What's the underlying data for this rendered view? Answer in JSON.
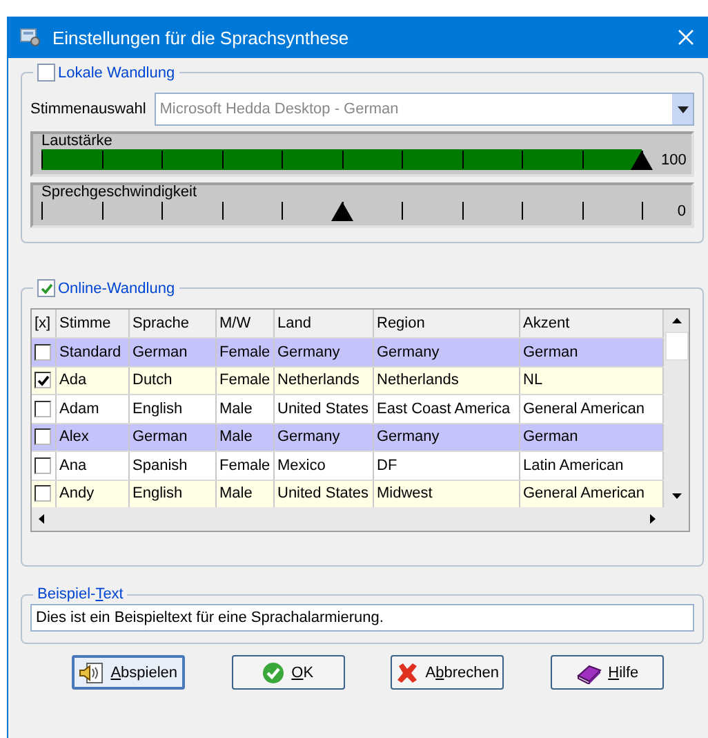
{
  "window": {
    "title": "Einstellungen für die Sprachsynthese"
  },
  "local_group": {
    "title": "Lokale Wandlung",
    "checked": false,
    "voice_select": {
      "label": "Stimmenauswahl",
      "value": "Microsoft Hedda Desktop - German"
    },
    "sliders": [
      {
        "kind": "filled",
        "label": "Lautstärke",
        "level": 1.0,
        "reading": "100"
      },
      {
        "kind": "plain",
        "label": "Sprechgeschwindigkeit",
        "level": 0.5,
        "reading": "0"
      }
    ]
  },
  "online_group": {
    "title": "Online-Wandlung",
    "checked": true,
    "table": {
      "checkbox_header": "[x]",
      "columns": [
        "Stimme",
        "Sprache",
        "M/W",
        "Land",
        "Region",
        "Akzent"
      ],
      "rows": [
        {
          "checked": false,
          "color": "#c4c4fa",
          "cells": [
            "Standard",
            "German",
            "Female",
            "Germany",
            "Germany",
            "German"
          ]
        },
        {
          "checked": true,
          "color": "#ffffe6",
          "cells": [
            "Ada",
            "Dutch",
            "Female",
            "Netherlands",
            "Netherlands",
            "NL"
          ]
        },
        {
          "checked": false,
          "color": "#ffffff",
          "cells": [
            "Adam",
            "English",
            "Male",
            "United States",
            "East Coast America",
            "General American"
          ]
        },
        {
          "checked": false,
          "color": "#c4c4fa",
          "cells": [
            "Alex",
            "German",
            "Male",
            "Germany",
            "Germany",
            "German"
          ]
        },
        {
          "checked": false,
          "color": "#ffffff",
          "cells": [
            "Ana",
            "Spanish",
            "Female",
            "Mexico",
            "DF",
            "Latin American"
          ]
        },
        {
          "checked": false,
          "color": "#ffffe6",
          "cells": [
            "Andy",
            "English",
            "Male",
            "United States",
            "Midwest",
            "General American"
          ]
        }
      ]
    }
  },
  "sample_group": {
    "title": {
      "before": "Beispiel-",
      "key": "T",
      "after": "ext"
    },
    "value": "Dies ist ein Beispieltext für eine Sprachalarmierung."
  },
  "buttons": [
    {
      "kind": "play",
      "label": {
        "key": "A",
        "after": "bspielen"
      }
    },
    {
      "kind": "ok",
      "label": {
        "key": "O",
        "after": "K"
      }
    },
    {
      "kind": "cancel",
      "label": {
        "before": "A",
        "key": "b",
        "after": "brechen"
      }
    },
    {
      "kind": "help",
      "label": {
        "key": "H",
        "after": "ilfe"
      }
    }
  ]
}
